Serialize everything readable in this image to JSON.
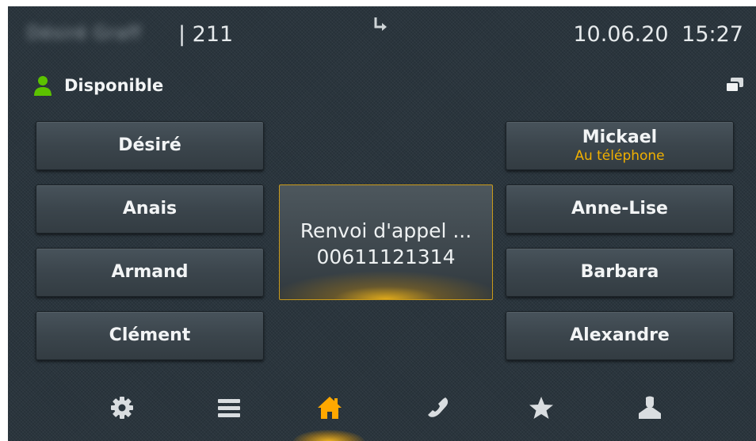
{
  "header": {
    "owner_name": "Désiré Graff",
    "extension": "| 211",
    "datetime": "10.06.20  15:27"
  },
  "status": {
    "label": "Disponible",
    "color": "#5cc200"
  },
  "speed_dial": {
    "left": [
      {
        "label": "Désiré"
      },
      {
        "label": "Anais"
      },
      {
        "label": "Armand"
      },
      {
        "label": "Clément"
      }
    ],
    "right": [
      {
        "label": "Mickael",
        "sublabel": "Au téléphone"
      },
      {
        "label": "Anne-Lise"
      },
      {
        "label": "Barbara"
      },
      {
        "label": "Alexandre"
      }
    ]
  },
  "forward_tile": {
    "line1": "Renvoi d'appel ...",
    "line2": "00611121314",
    "accent_color": "#f1b000"
  },
  "nav": {
    "items": [
      {
        "icon": "gear-icon"
      },
      {
        "icon": "menu-icon"
      },
      {
        "icon": "home-icon",
        "active": true
      },
      {
        "icon": "phone-icon"
      },
      {
        "icon": "star-icon"
      },
      {
        "icon": "person-icon"
      }
    ],
    "active_color": "#ffa800"
  }
}
